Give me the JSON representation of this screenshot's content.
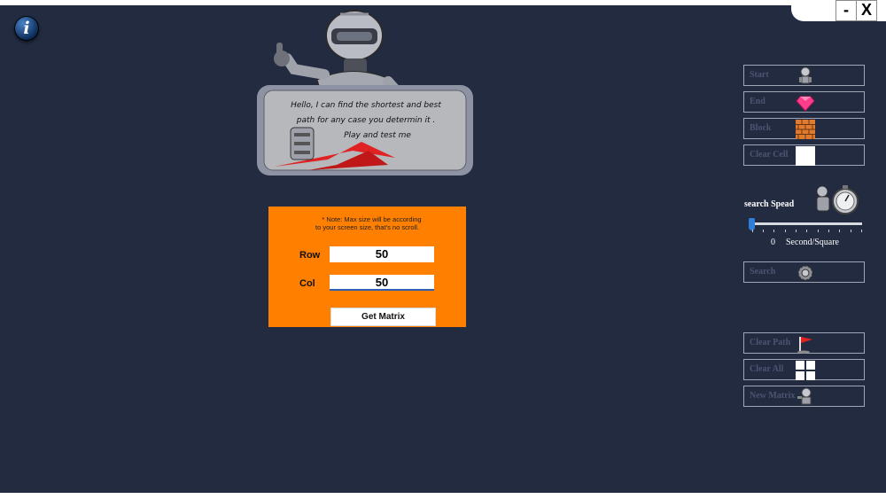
{
  "window": {
    "minimize_label": "-",
    "close_label": "X"
  },
  "info_label": "i",
  "robot_board": {
    "line1": "Hello, I can find the shortest and best",
    "line2": "path for any case you determin it .",
    "line3": "Play and test me"
  },
  "matrix_panel": {
    "note_line1": "*  Note: Max size will be according",
    "note_line2": "to your screen size, that's no scroll.",
    "row_label": "Row",
    "row_value": "50",
    "col_label": "Col",
    "col_value": "50",
    "get_matrix_label": "Get Matrix"
  },
  "side_panel": {
    "start_label": "Start",
    "end_label": "End",
    "block_label": "Block",
    "clear_cell_label": "Clear Cell",
    "search_speed_label": "search Spead",
    "speed_value": "0",
    "speed_unit": "Second/Square",
    "search_label": "Search",
    "clear_path_label": "Clear Path",
    "clear_all_label": "Clear All",
    "new_matrix_label": "New Matrix"
  },
  "colors": {
    "background": "#222b40",
    "panel_orange": "#ff7f00",
    "side_border": "#a0a6b5",
    "slider_thumb": "#2f7fd8"
  }
}
